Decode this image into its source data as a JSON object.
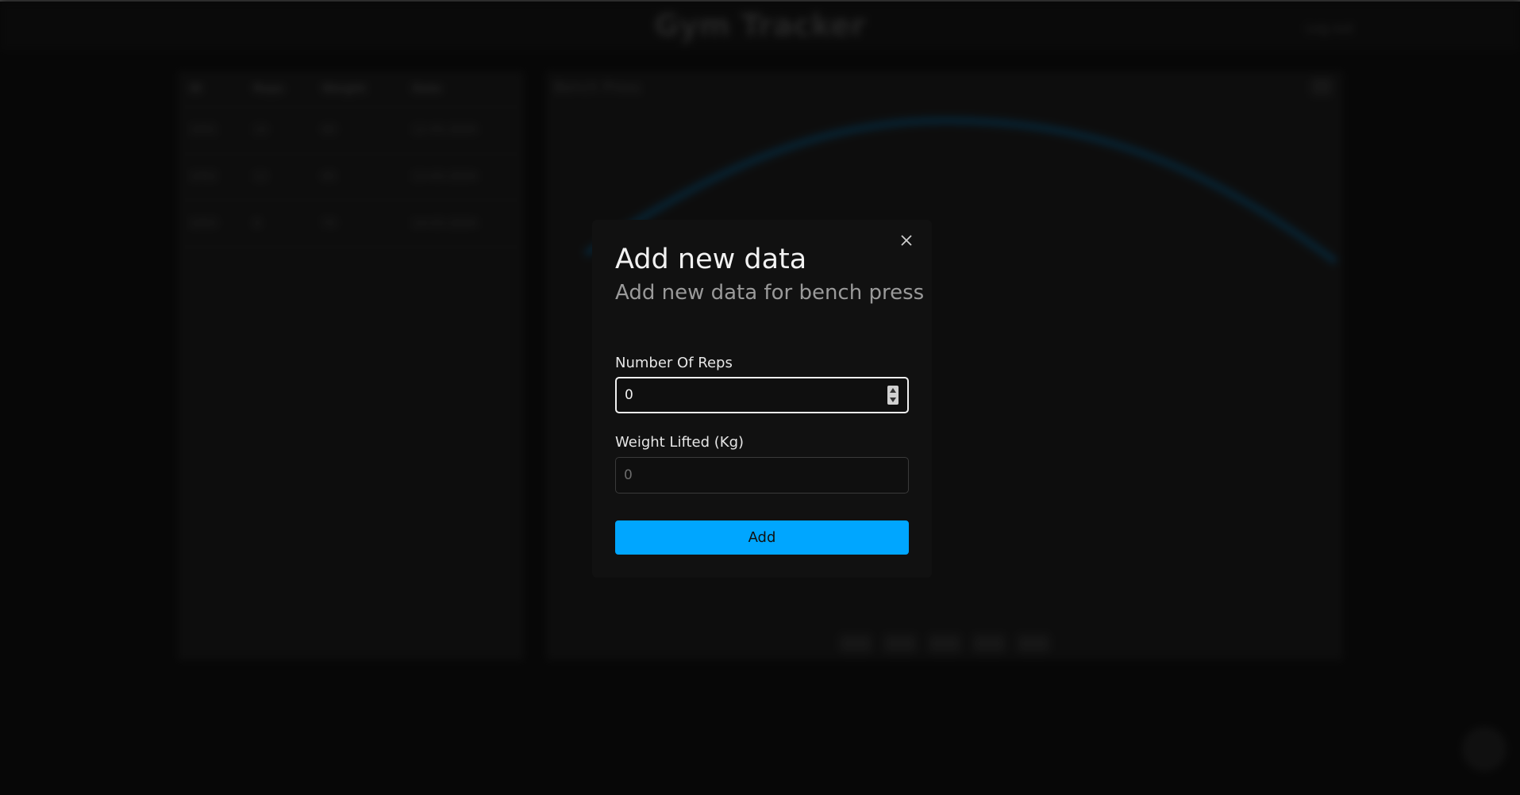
{
  "app": {
    "title": "Gym Tracker",
    "header_link": "Log out"
  },
  "background_table": {
    "headers": [
      "ID",
      "Reps",
      "Weight",
      "Date"
    ],
    "rows": [
      [
        "1001",
        "10",
        "60",
        "12-03-2024"
      ],
      [
        "1002",
        "12",
        "65",
        "13-03-2024"
      ],
      [
        "1003",
        "8",
        "70",
        "14-03-2024"
      ]
    ]
  },
  "background_chart": {
    "title": "Bench Press"
  },
  "modal": {
    "title": "Add new data",
    "subtitle": "Add new data for bench press",
    "reps_label": "Number Of Reps",
    "reps_value": "0",
    "weight_label": "Weight Lifted (Kg)",
    "weight_placeholder": "0",
    "add_label": "Add",
    "close_icon": "close-icon"
  },
  "colors": {
    "accent": "#00a6ff",
    "modal_bg": "#111111",
    "page_bg": "#0c0c0c"
  }
}
